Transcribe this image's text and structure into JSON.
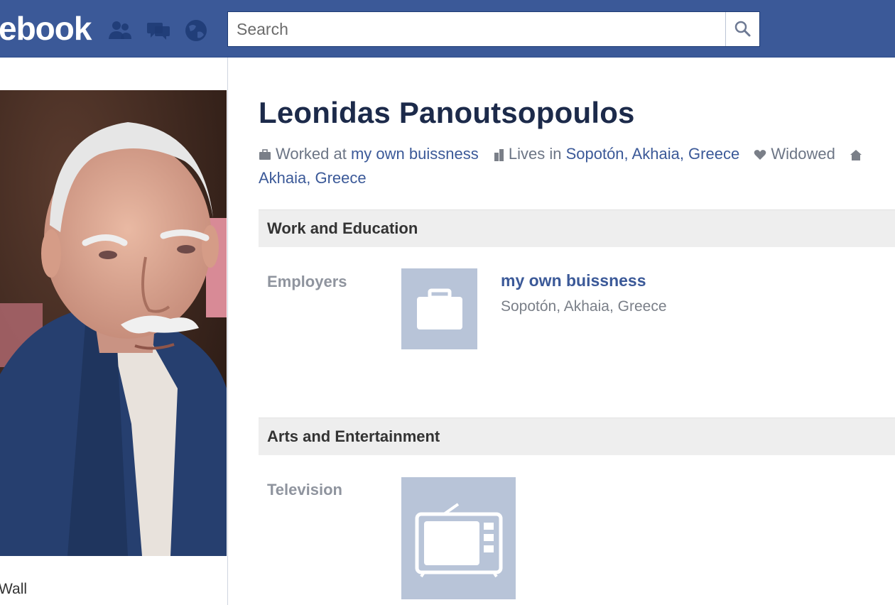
{
  "header": {
    "logo_text": "ebook",
    "search_placeholder": "Search",
    "brand_color": "#3b5998"
  },
  "left": {
    "wall_label": "Wall"
  },
  "profile": {
    "name": "Leonidas Panoutsopoulos",
    "meta": {
      "worked_prefix": "Worked at",
      "worked_link": "my own buissness",
      "lives_prefix": "Lives in",
      "lives_link": "Sopotón, Akhaia, Greece",
      "status": "Widowed",
      "from_link_continued": "Akhaia, Greece"
    }
  },
  "sections": {
    "work": {
      "title": "Work and Education",
      "employers_label": "Employers",
      "employer_name": "my own buissness",
      "employer_location": "Sopotón, Akhaia, Greece"
    },
    "arts": {
      "title": "Arts and Entertainment",
      "television_label": "Television"
    }
  }
}
